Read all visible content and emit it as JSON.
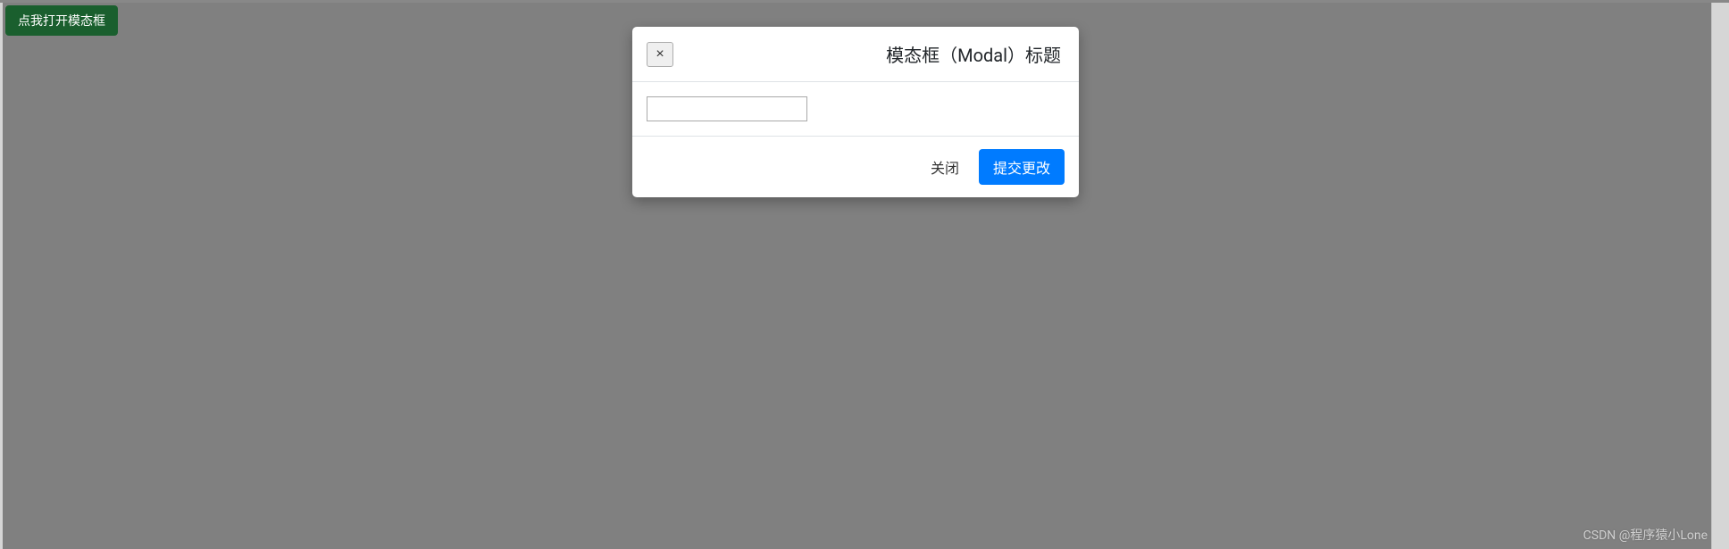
{
  "trigger": {
    "label": "点我打开模态框"
  },
  "modal": {
    "close_symbol": "×",
    "title": "模态框（Modal）标题",
    "input_value": "",
    "footer": {
      "close_label": "关闭",
      "submit_label": "提交更改"
    }
  },
  "watermark": "CSDN @程序猿小Lone"
}
